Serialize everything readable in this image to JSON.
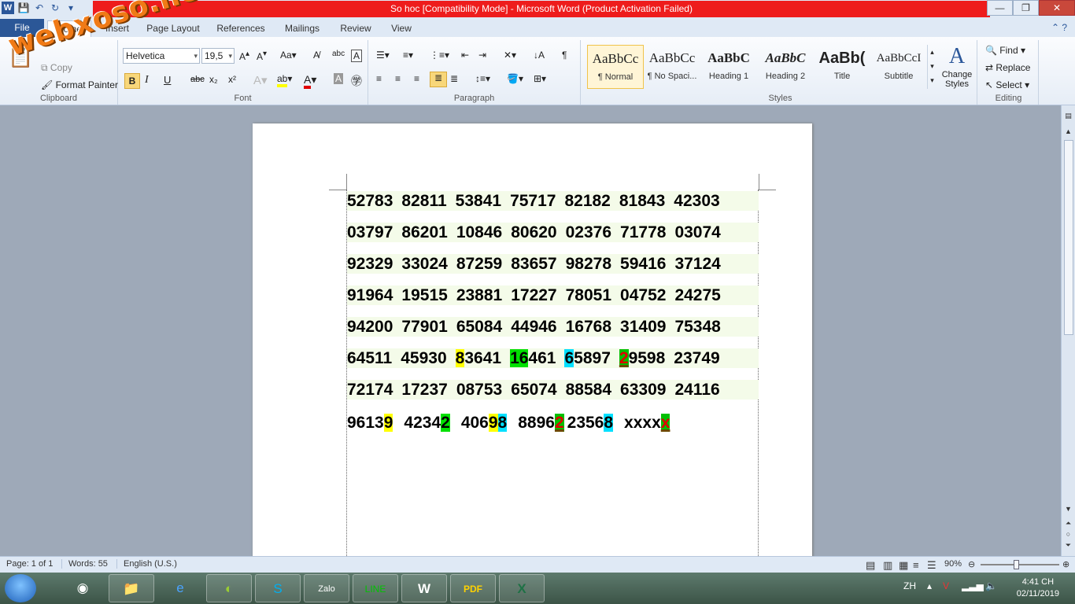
{
  "window": {
    "title": "So hoc [Compatibility Mode] -  Microsoft Word (Product Activation Failed)",
    "title_bar_color": "#ee1c1c"
  },
  "watermark": "webxoso.net",
  "tabs": [
    "File",
    "Home",
    "Insert",
    "Page Layout",
    "References",
    "Mailings",
    "Review",
    "View"
  ],
  "clipboard": {
    "copy": "Copy",
    "format_painter": "Format Painter",
    "label": "Clipboard"
  },
  "font": {
    "family": "Helvetica",
    "size": "19,5",
    "label": "Font",
    "bold": "B",
    "italic": "I",
    "underline": "U",
    "strike": "abc",
    "sub": "x₂",
    "sup": "x²"
  },
  "paragraph": {
    "label": "Paragraph"
  },
  "styles": {
    "label": "Styles",
    "items": [
      {
        "sample": "AaBbCc",
        "name": "¶ Normal"
      },
      {
        "sample": "AaBbCc",
        "name": "¶ No Spaci..."
      },
      {
        "sample": "AaBbC",
        "name": "Heading 1"
      },
      {
        "sample": "AaBbC",
        "name": "Heading 2"
      },
      {
        "sample": "AaBb(",
        "name": "Title"
      },
      {
        "sample": "AaBbCcI",
        "name": "Subtitle"
      }
    ],
    "change_styles": "Change Styles"
  },
  "editing": {
    "label": "Editing",
    "find": "Find",
    "replace": "Replace",
    "select": "Select"
  },
  "document": {
    "rows": [
      [
        "52783",
        "82811",
        "53841",
        "75717",
        "82182",
        "81843",
        "42303"
      ],
      [
        "03797",
        "86201",
        "10846",
        "80620",
        "02376",
        "71778",
        "03074"
      ],
      [
        "92329",
        "33024",
        "87259",
        "83657",
        "98278",
        "59416",
        "37124"
      ],
      [
        "91964",
        "19515",
        "23881",
        "17227",
        "78051",
        "04752",
        "24275"
      ],
      [
        "94200",
        "77901",
        "65084",
        "44946",
        "16768",
        "31409",
        "75348"
      ]
    ],
    "row6": {
      "a": "64511",
      "b": "45930",
      "c_hl": "8",
      "c_rest": "3641",
      "d_hl": "16",
      "d_rest": "461",
      "e_hl": "6",
      "e_rest": "5897",
      "f_hl": "2",
      "f_rest": "9598",
      "g": "23749"
    },
    "row7": [
      "72174",
      "17237",
      "08753",
      "65074",
      "88584",
      "63309",
      "24116"
    ],
    "row8": {
      "a_pre": "9613",
      "a_hl": "9",
      "b_pre": "4234",
      "b_hl": "2",
      "c_pre": "406",
      "c_hl1": "9",
      "c_hl2": "8",
      "d_pre": "8896",
      "d_hl": "2",
      "e_pre": "2356",
      "e_hl": "8",
      "f_pre": "xxxx",
      "f_hl": "x"
    }
  },
  "status": {
    "page": "Page: 1 of 1",
    "words": "Words: 55",
    "language": "English (U.S.)",
    "zoom": "90%",
    "zoom_value": 0.9
  },
  "taskbar": {
    "lang": "ZH",
    "time": "4:41 CH",
    "date": "02/11/2019",
    "apps": [
      "chrome",
      "explorer",
      "internet-explorer",
      "coccoc",
      "skype",
      "zalo",
      "line",
      "word",
      "pdf",
      "excel"
    ]
  }
}
